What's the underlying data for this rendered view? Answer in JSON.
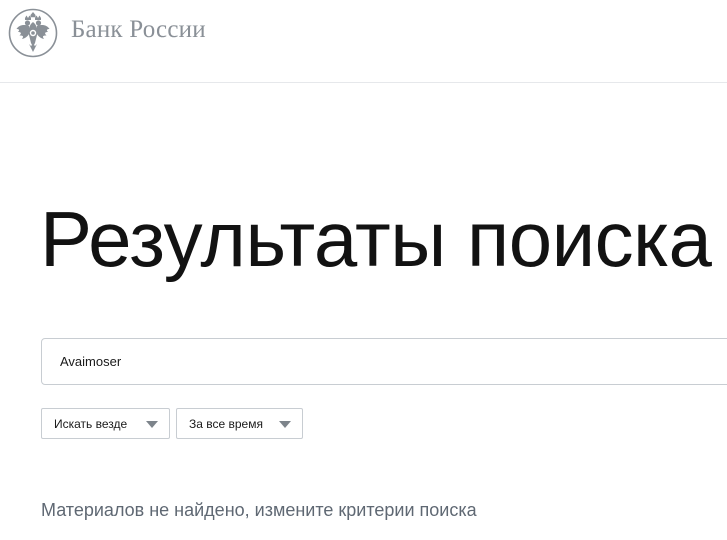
{
  "header": {
    "brand": "Банк России",
    "logo_icon": "double-headed-eagle-emblem",
    "brand_color": "#8a9097"
  },
  "main": {
    "title": "Результаты поиска",
    "search": {
      "value": "Avaimoser"
    },
    "filters": [
      {
        "label": "Искать везде",
        "icon": "caret-down-icon"
      },
      {
        "label": "За все время",
        "icon": "caret-down-icon"
      }
    ],
    "empty_message": "Материалов не найдено, измените критерии поиска"
  }
}
